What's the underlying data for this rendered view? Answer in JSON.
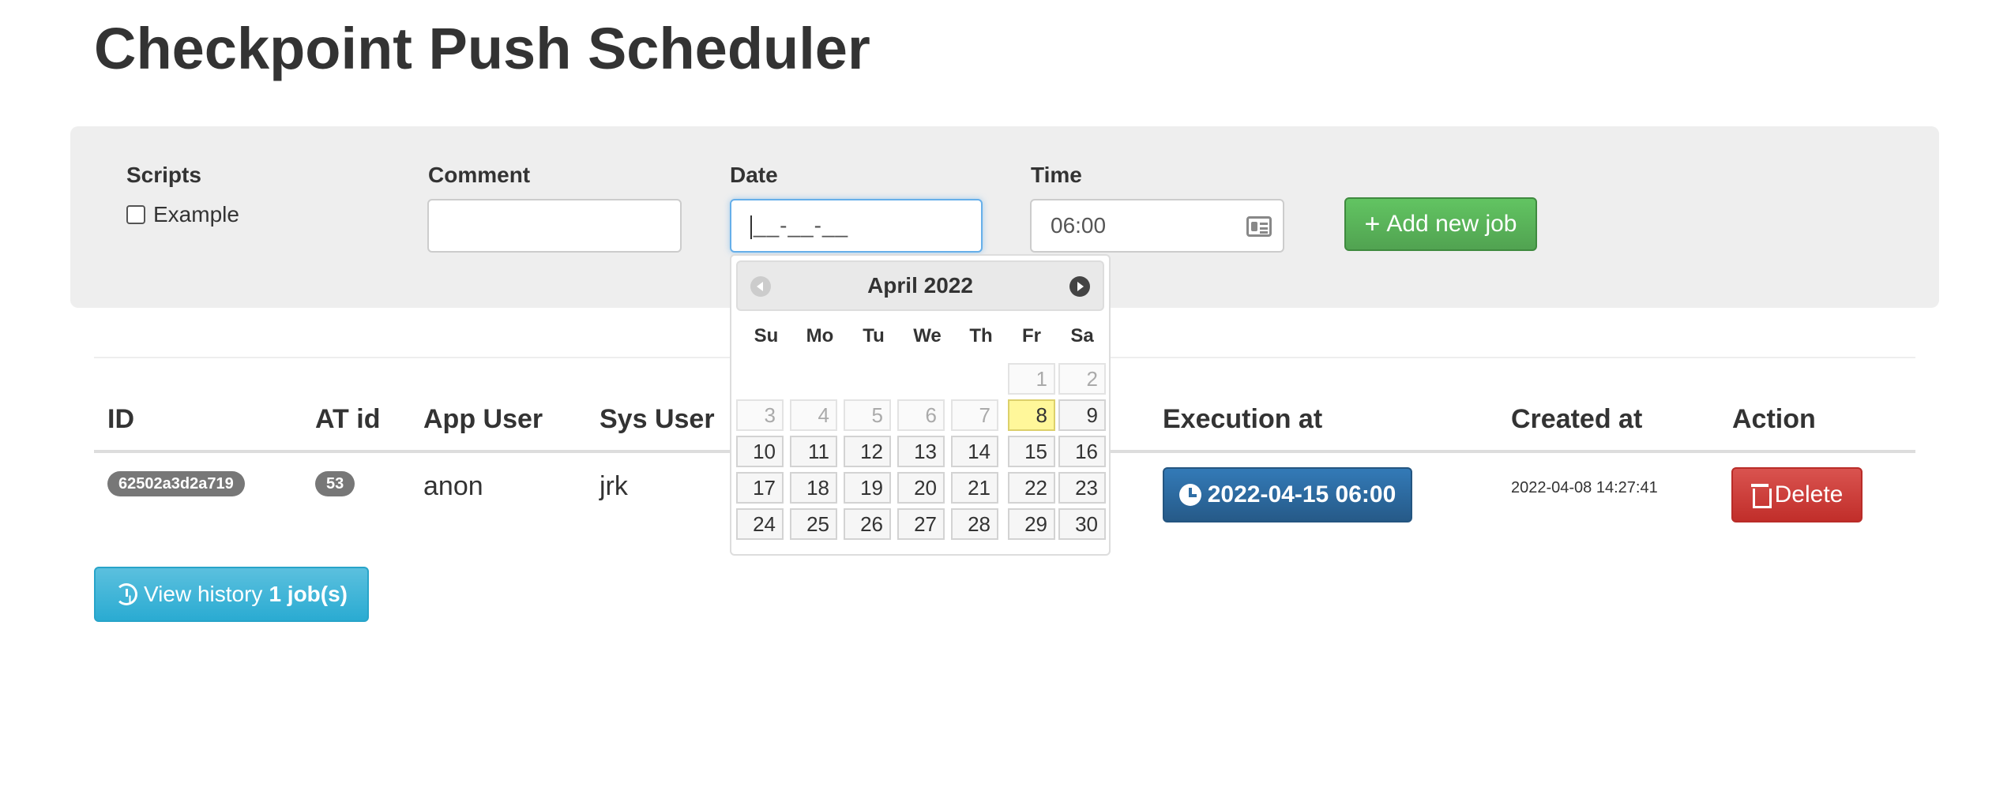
{
  "title": "Checkpoint Push Scheduler",
  "form": {
    "scripts_label": "Scripts",
    "script_option": "Example",
    "comment_label": "Comment",
    "comment_value": "",
    "date_label": "Date",
    "date_mask": "__-__-__",
    "time_label": "Time",
    "time_value": "06:00",
    "add_button": "Add new job"
  },
  "datepicker": {
    "month_title": "April 2022",
    "weekdays": [
      "Su",
      "Mo",
      "Tu",
      "We",
      "Th",
      "Fr",
      "Sa"
    ],
    "days": [
      "1",
      "2",
      "3",
      "4",
      "5",
      "6",
      "7",
      "8",
      "9",
      "10",
      "11",
      "12",
      "13",
      "14",
      "15",
      "16",
      "17",
      "18",
      "19",
      "20",
      "21",
      "22",
      "23",
      "24",
      "25",
      "26",
      "27",
      "28",
      "29",
      "30"
    ],
    "today": "8"
  },
  "table": {
    "headers": {
      "id": "ID",
      "at_id": "AT id",
      "app_user": "App User",
      "sys_user": "Sys User",
      "execution_at": "Execution at",
      "created_at": "Created at",
      "action": "Action"
    },
    "rows": [
      {
        "id": "62502a3d2a719",
        "at_id": "53",
        "app_user": "anon",
        "sys_user": "jrk",
        "execution_at": "2022-04-15 06:00",
        "created_at": "2022-04-08 14:27:41",
        "action": "Delete"
      }
    ]
  },
  "history": {
    "label": "View history",
    "count": "1 job(s)"
  },
  "colors": {
    "primary": "#337ab7",
    "success": "#51a351",
    "danger": "#d9534f",
    "info": "#5bc0de",
    "today_highlight": "#fff79a"
  },
  "icons": [
    "plus-icon",
    "time-card-icon",
    "clock-icon",
    "trash-icon",
    "history-icon",
    "prev-month-icon",
    "next-month-icon"
  ]
}
